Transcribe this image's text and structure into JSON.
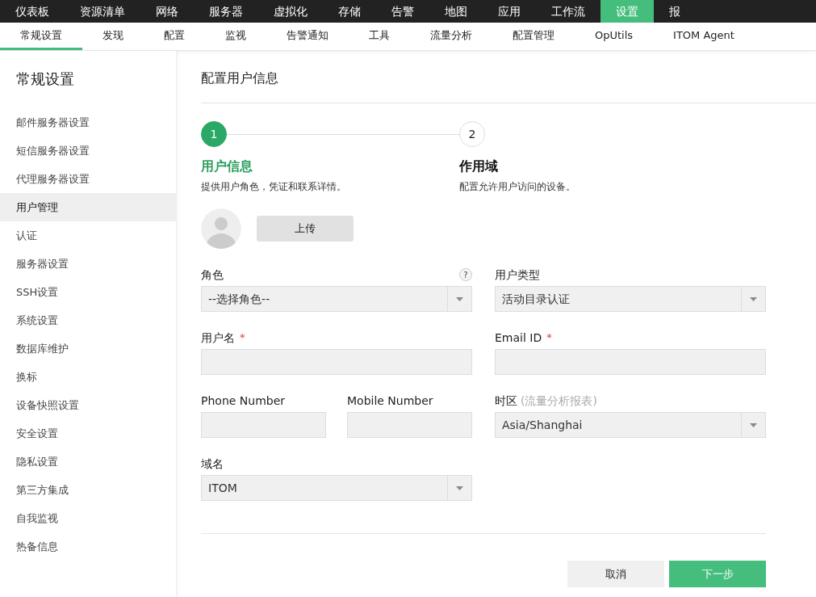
{
  "top_nav": [
    {
      "label": "仪表板",
      "selected": false
    },
    {
      "label": "资源清单",
      "selected": false
    },
    {
      "label": "网络",
      "selected": false
    },
    {
      "label": "服务器",
      "selected": false
    },
    {
      "label": "虚拟化",
      "selected": false
    },
    {
      "label": "存储",
      "selected": false
    },
    {
      "label": "告警",
      "selected": false
    },
    {
      "label": "地图",
      "selected": false
    },
    {
      "label": "应用",
      "selected": false
    },
    {
      "label": "工作流",
      "selected": false
    },
    {
      "label": "设置",
      "selected": true
    },
    {
      "label": "报",
      "selected": false
    }
  ],
  "sub_nav": [
    {
      "label": "常规设置",
      "selected": true
    },
    {
      "label": "发现",
      "selected": false
    },
    {
      "label": "配置",
      "selected": false
    },
    {
      "label": "监视",
      "selected": false
    },
    {
      "label": "告警通知",
      "selected": false
    },
    {
      "label": "工具",
      "selected": false
    },
    {
      "label": "流量分析",
      "selected": false
    },
    {
      "label": "配置管理",
      "selected": false
    },
    {
      "label": "OpUtils",
      "selected": false
    },
    {
      "label": "ITOM Agent",
      "selected": false
    }
  ],
  "sidebar": {
    "title": "常规设置",
    "items": [
      {
        "label": "邮件服务器设置",
        "selected": false
      },
      {
        "label": "短信服务器设置",
        "selected": false
      },
      {
        "label": "代理服务器设置",
        "selected": false
      },
      {
        "label": "用户管理",
        "selected": true
      },
      {
        "label": "认证",
        "selected": false
      },
      {
        "label": "服务器设置",
        "selected": false
      },
      {
        "label": "SSH设置",
        "selected": false
      },
      {
        "label": "系统设置",
        "selected": false
      },
      {
        "label": "数据库维护",
        "selected": false
      },
      {
        "label": "换标",
        "selected": false
      },
      {
        "label": "设备快照设置",
        "selected": false
      },
      {
        "label": "安全设置",
        "selected": false
      },
      {
        "label": "隐私设置",
        "selected": false
      },
      {
        "label": "第三方集成",
        "selected": false
      },
      {
        "label": "自我监视",
        "selected": false
      },
      {
        "label": "热备信息",
        "selected": false
      }
    ]
  },
  "page_title": "配置用户信息",
  "steps": [
    {
      "number": "1",
      "title": "用户信息",
      "description": "提供用户角色，凭证和联系详情。",
      "selected": true
    },
    {
      "number": "2",
      "title": "作用域",
      "description": "配置允许用户访问的设备。",
      "selected": false
    }
  ],
  "avatar": {
    "upload_button": "上传"
  },
  "form_rows": [
    {
      "left": [
        {
          "kind": "select",
          "label": "角色",
          "help": "?",
          "value": "--选择角色--"
        }
      ],
      "right": [
        {
          "kind": "select",
          "label": "用户类型",
          "value": "活动目录认证"
        }
      ]
    },
    {
      "left": [
        {
          "kind": "input",
          "label": "用户名",
          "required_mark": "*"
        }
      ],
      "right": [
        {
          "kind": "input",
          "label": "Email ID",
          "required_mark": "*"
        }
      ]
    },
    {
      "left": [
        {
          "kind": "input",
          "label": "Phone Number"
        },
        {
          "kind": "input",
          "label": "Mobile Number"
        }
      ],
      "right": [
        {
          "kind": "select",
          "label": "时区",
          "hint": "(流量分析报表)",
          "value": "Asia/Shanghai"
        }
      ]
    },
    {
      "left": [
        {
          "kind": "select",
          "label": "域名",
          "value": "ITOM"
        }
      ],
      "right": []
    }
  ],
  "buttons": [
    {
      "kind": "secondary",
      "label": "取消"
    },
    {
      "kind": "primary",
      "label": "下一步"
    }
  ]
}
